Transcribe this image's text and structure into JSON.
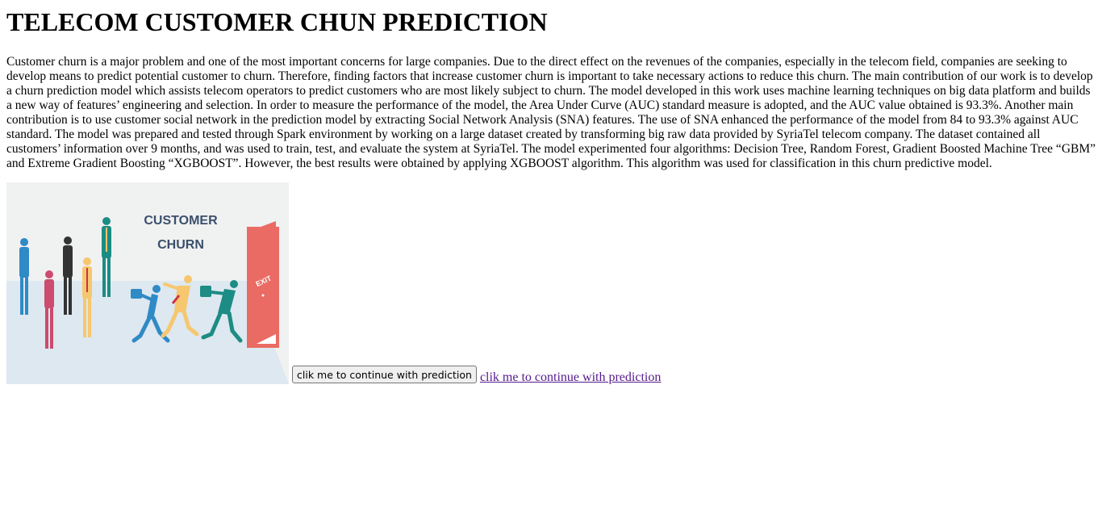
{
  "page": {
    "title": "TELECOM CUSTOMER CHUN PREDICTION",
    "description": "Customer churn is a major problem and one of the most important concerns for large companies. Due to the direct effect on the revenues of the companies, especially in the telecom field, companies are seeking to develop means to predict potential customer to churn. Therefore, finding factors that increase customer churn is important to take necessary actions to reduce this churn. The main contribution of our work is to develop a churn prediction model which assists telecom operators to predict customers who are most likely subject to churn. The model developed in this work uses machine learning techniques on big data platform and builds a new way of features’ engineering and selection. In order to measure the performance of the model, the Area Under Curve (AUC) standard measure is adopted, and the AUC value obtained is 93.3%. Another main contribution is to use customer social network in the prediction model by extracting Social Network Analysis (SNA) features. The use of SNA enhanced the performance of the model from 84 to 93.3% against AUC standard. The model was prepared and tested through Spark environment by working on a large dataset created by transforming big raw data provided by SyriaTel telecom company. The dataset contained all customers’ information over 9 months, and was used to train, test, and evaluate the system at SyriaTel. The model experimented four algorithms: Decision Tree, Random Forest, Gradient Boosted Machine Tree “GBM” and Extreme Gradient Boosting “XGBOOST”. However, the best results were obtained by applying XGBOOST algorithm. This algorithm was used for classification in this churn predictive model."
  },
  "illustration": {
    "line1": "CUSTOMER",
    "line2": "CHURN",
    "door_sign": "EXIT",
    "colors": {
      "wall": "#f0f1f1",
      "floor": "#dde8f0",
      "heading": "#3b4f6b",
      "door": "#ea6b63",
      "blue": "#2f8ac6",
      "pink": "#cc4b6e",
      "dark": "#333333",
      "yellow": "#f6c76f",
      "teal": "#1c8c84"
    }
  },
  "actions": {
    "button_label": "clik me to continue with prediction",
    "link_label": "clik me to continue with prediction"
  }
}
